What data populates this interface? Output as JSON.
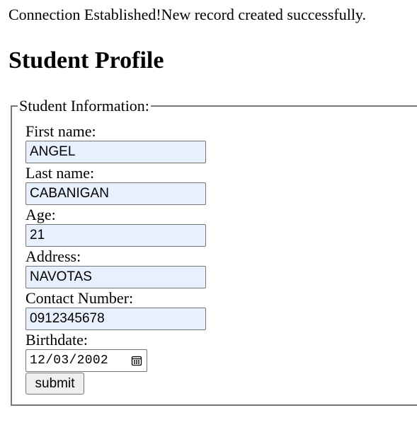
{
  "status_message": "Connection Established!New record created successfully.",
  "page_title": "Student Profile",
  "form": {
    "legend": "Student Information:",
    "fields": {
      "first_name": {
        "label": "First name:",
        "value": "ANGEL"
      },
      "last_name": {
        "label": "Last name:",
        "value": "CABANIGAN"
      },
      "age": {
        "label": "Age:",
        "value": "21"
      },
      "address": {
        "label": "Address:",
        "value": "NAVOTAS"
      },
      "contact_number": {
        "label": "Contact Number:",
        "value": "0912345678"
      },
      "birthdate": {
        "label": "Birthdate:",
        "value": "12/03/2002",
        "icon": "calendar-icon"
      }
    },
    "submit_label": "submit"
  },
  "colors": {
    "autofill_background": "#e8f0fe",
    "border": "#767676",
    "button_background": "#efefef"
  }
}
